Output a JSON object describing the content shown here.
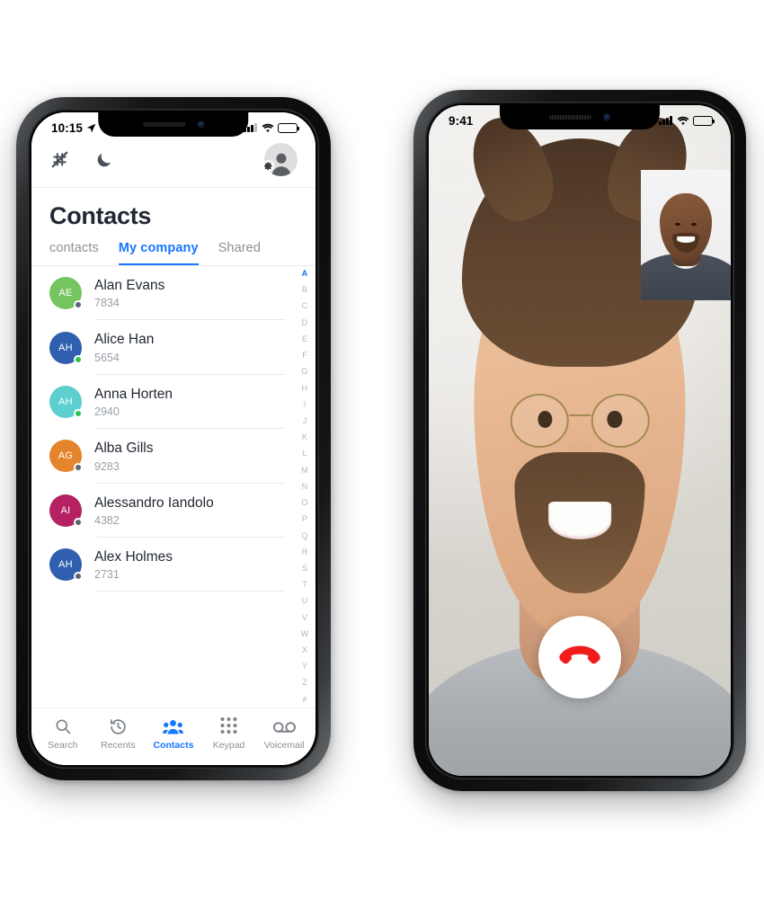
{
  "colors": {
    "accent": "#1677ff",
    "end_call_red": "#f01c1c",
    "battery_low": "#f5b50a",
    "online_green": "#2fc24d",
    "offline_grey": "#5b6470"
  },
  "left_phone": {
    "status_bar": {
      "time": "10:15",
      "location_icon": "location-arrow-icon",
      "signal_icon": "cellular-signal-icon",
      "wifi_icon": "wifi-icon",
      "battery_icon": "battery-low-power-icon"
    },
    "header": {
      "grid_icon": "crossed-grid-icon",
      "moon_icon": "do-not-disturb-moon-icon",
      "avatar_icon": "user-avatar-icon",
      "gear_icon": "settings-gear-icon"
    },
    "page_title": "Contacts",
    "tabs": [
      {
        "label": "contacts",
        "active": false
      },
      {
        "label": "My company",
        "active": true
      },
      {
        "label": "Shared",
        "active": false
      }
    ],
    "contacts": [
      {
        "initials": "AE",
        "name": "Alan Evans",
        "extension": "7834",
        "color": "#74c560",
        "status": "offline"
      },
      {
        "initials": "AH",
        "name": "Alice Han",
        "extension": "5654",
        "color": "#2f5fae",
        "status": "online"
      },
      {
        "initials": "AH",
        "name": "Anna Horten",
        "extension": "2940",
        "color": "#5ecfcf",
        "status": "online"
      },
      {
        "initials": "AG",
        "name": "Alba Gills",
        "extension": "9283",
        "color": "#e4842c",
        "status": "offline"
      },
      {
        "initials": "AI",
        "name": "Alessandro Iandolo",
        "extension": "4382",
        "color": "#b52163",
        "status": "offline"
      },
      {
        "initials": "AH",
        "name": "Alex Holmes",
        "extension": "2731",
        "color": "#2f5fae",
        "status": "offline"
      }
    ],
    "alpha_index": [
      "A",
      "B",
      "C",
      "D",
      "E",
      "F",
      "G",
      "H",
      "I",
      "J",
      "K",
      "L",
      "M",
      "N",
      "O",
      "P",
      "Q",
      "R",
      "S",
      "T",
      "U",
      "V",
      "W",
      "X",
      "Y",
      "Z",
      "#"
    ],
    "alpha_index_active": "A",
    "tabbar": [
      {
        "label": "Search",
        "icon": "search-icon",
        "active": false
      },
      {
        "label": "Recents",
        "icon": "recents-clock-icon",
        "active": false
      },
      {
        "label": "Contacts",
        "icon": "contacts-people-icon",
        "active": true
      },
      {
        "label": "Keypad",
        "icon": "keypad-dots-icon",
        "active": false
      },
      {
        "label": "Voicemail",
        "icon": "voicemail-icon",
        "active": false
      }
    ]
  },
  "right_phone": {
    "status_bar": {
      "time": "9:41",
      "signal_icon": "cellular-signal-icon",
      "wifi_icon": "wifi-icon",
      "battery_icon": "battery-full-icon"
    },
    "call": {
      "remote_video": "remote-participant-video",
      "self_video": "self-view-picture-in-picture",
      "end_call_icon": "end-call-handset-icon"
    }
  }
}
